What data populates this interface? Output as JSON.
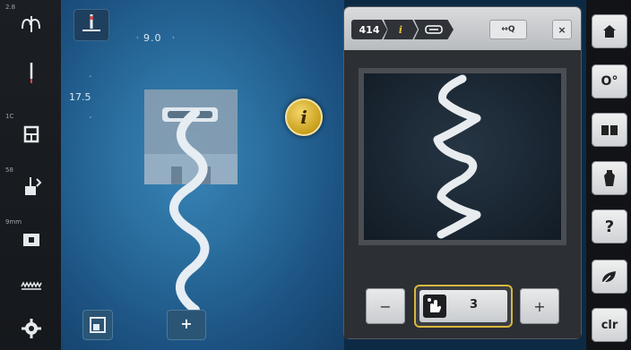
{
  "left_sidebar": {
    "items": [
      {
        "top_label": "2.8",
        "icon": "thread-tension-icon"
      },
      {
        "top_label": "",
        "icon": "needle-icon"
      },
      {
        "top_label": "1C",
        "icon": "presser-foot-icon"
      },
      {
        "top_label": "58",
        "icon": "presser-foot-pressure-icon"
      },
      {
        "top_label": "9mm",
        "icon": "stitch-plate-icon"
      },
      {
        "top_label": "",
        "icon": "feed-dog-icon"
      },
      {
        "top_label": "",
        "icon": "settings-gear-icon"
      }
    ]
  },
  "main": {
    "stitch_width": "9.0",
    "stitch_length": "17.5",
    "info_button_label": "i",
    "bottom_center_label": "+"
  },
  "panel": {
    "stitch_number": "414",
    "info_crumb": "i",
    "zoom_label": "↔Q",
    "close_label": "×",
    "stepper": {
      "minus_label": "−",
      "value": "3",
      "plus_label": "+"
    }
  },
  "right_sidebar": {
    "items": [
      {
        "icon": "home-icon",
        "label": ""
      },
      {
        "icon": "setup-icon",
        "label": "O°"
      },
      {
        "icon": "tutorial-icon",
        "label": ""
      },
      {
        "icon": "creative-consultant-icon",
        "label": ""
      },
      {
        "icon": "help-icon",
        "label": "?"
      },
      {
        "icon": "eco-icon",
        "label": ""
      },
      {
        "icon": "clear-icon",
        "label": "clr"
      }
    ]
  },
  "colors": {
    "accent_gold": "#d9b73c",
    "main_blue": "#2a6f9f"
  }
}
